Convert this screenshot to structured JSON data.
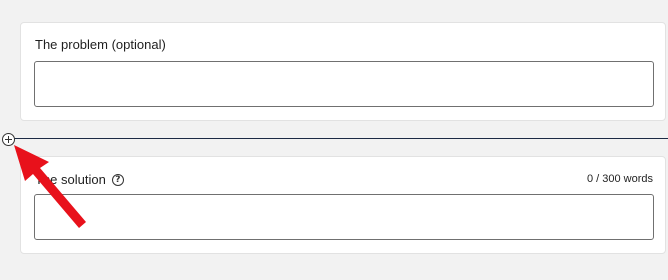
{
  "form": {
    "problem": {
      "label": "The problem (optional)",
      "value": ""
    },
    "solution": {
      "label": "The solution",
      "help_icon": "question-circle-icon",
      "word_count": "0 / 300 words",
      "value": ""
    },
    "add_section_icon": "plus-circle-icon"
  },
  "annotation": {
    "color": "#e8111b",
    "icon": "arrow-annotation"
  },
  "colors": {
    "divider": "#1c2a44",
    "background": "#f2f2f2"
  }
}
